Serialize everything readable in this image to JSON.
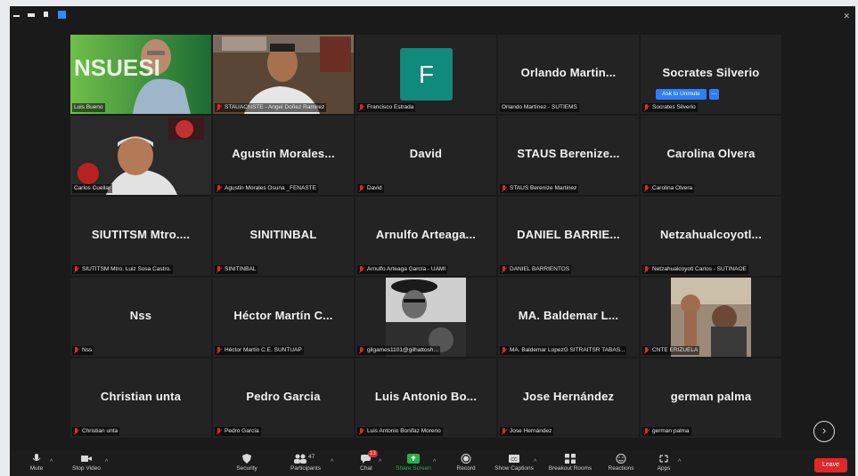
{
  "tiles": [
    {
      "name": "",
      "label": "Luis Bueno",
      "muted": false
    },
    {
      "name": "",
      "label": "STAUAChiSTE - Angel Doñez Ramirez",
      "muted": true
    },
    {
      "name": "",
      "label": "Francisco Estrada",
      "muted": true,
      "avatar": "F"
    },
    {
      "name": "Orlando  Martin...",
      "label": "Orlando Martínez - SUTIEMS",
      "muted": false
    },
    {
      "name": "Socrates Silverio",
      "label": "Socrates Silverio",
      "muted": true
    },
    {
      "name": "",
      "label": "Carlos Cuellar",
      "muted": false
    },
    {
      "name": "Agustin Morales...",
      "label": "Agustin Morales Osuna _FENASTE",
      "muted": true
    },
    {
      "name": "David",
      "label": "David",
      "muted": true
    },
    {
      "name": "STAUS  Berenize...",
      "label": "STAUS Berenize Martinez",
      "muted": true
    },
    {
      "name": "Carolina Olvera",
      "label": "Carolina Olvera",
      "muted": true
    },
    {
      "name": "SIUTITSM  Mtro....",
      "label": "SIUTITSM Mtro. Luiz Sosa Castro.",
      "muted": true
    },
    {
      "name": "SINITINBAL",
      "label": "SINITINBAL",
      "muted": true
    },
    {
      "name": "Arnulfo  Arteaga...",
      "label": "Arnulfo Arteaga García - UAMI",
      "muted": true
    },
    {
      "name": "DANIEL  BARRIE...",
      "label": "DANIEL BARRIENTOS",
      "muted": true
    },
    {
      "name": "Netzahualcoyotl...",
      "label": "Netzahualcoyotl Carlos - SUTINAOE",
      "muted": true
    },
    {
      "name": "Nss",
      "label": "Nss",
      "muted": true
    },
    {
      "name": "Héctor  Martín  C...",
      "label": "Héctor Martín C.E. SUNTUAP",
      "muted": true
    },
    {
      "name": "",
      "label": "gilgames1101@gilhattosh...",
      "muted": true
    },
    {
      "name": "MA.  Baldemar  L...",
      "label": "MA. Baldemar LopezG SITRAITSR TABAS...",
      "muted": true
    },
    {
      "name": "",
      "label": "CNTE ERIZUELA",
      "muted": true
    },
    {
      "name": "Christian  unta",
      "label": "Christian unta",
      "muted": true
    },
    {
      "name": "Pedro Garcia",
      "label": "Pedro García",
      "muted": true
    },
    {
      "name": "Luis  Antonio  Bo...",
      "label": "Luis Antonio Bonifaz Moreno",
      "muted": true
    },
    {
      "name": "Jose Hernández",
      "label": "Jose Hernández",
      "muted": true
    },
    {
      "name": "german palma",
      "label": "german palma",
      "muted": true
    }
  ],
  "ask_to_unmute": "Ask to Unmute",
  "more": "...",
  "toolbar": {
    "mute": "Mute",
    "stop_video": "Stop Video",
    "security": "Security",
    "participants": "Participants",
    "participants_count": "47",
    "chat": "Chat",
    "chat_badge": "13",
    "share_screen": "Share Screen",
    "record": "Record",
    "show_captions": "Show Captions",
    "breakout_rooms": "Breakout Rooms",
    "reactions": "Reactions",
    "apps": "Apps",
    "leave": "Leave"
  },
  "logo_text": "NSUESI",
  "colors": {
    "accent": "#2d8cff",
    "mute_red": "#e02828",
    "active_speaker": "#d6e85a",
    "share_green": "#23b24b"
  }
}
